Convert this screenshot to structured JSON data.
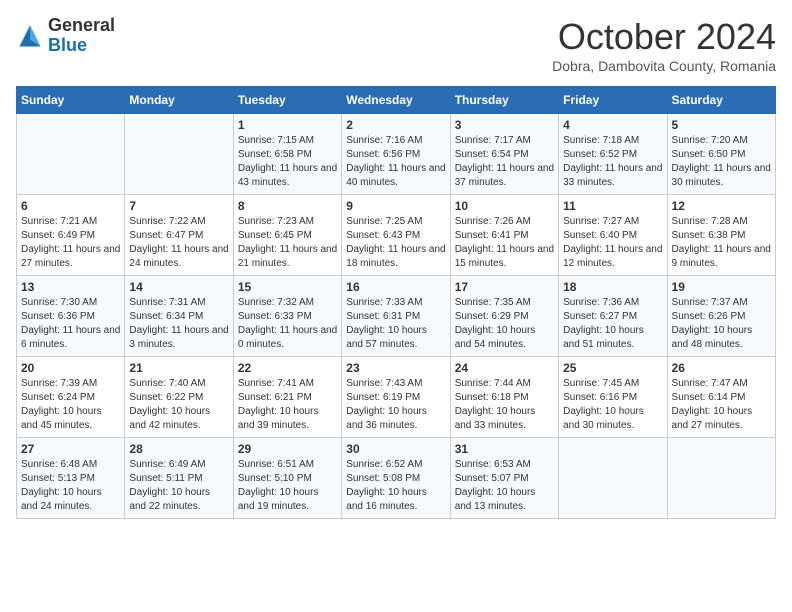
{
  "header": {
    "logo_general": "General",
    "logo_blue": "Blue",
    "month": "October 2024",
    "location": "Dobra, Dambovita County, Romania"
  },
  "days_of_week": [
    "Sunday",
    "Monday",
    "Tuesday",
    "Wednesday",
    "Thursday",
    "Friday",
    "Saturday"
  ],
  "weeks": [
    [
      {
        "day": "",
        "info": ""
      },
      {
        "day": "",
        "info": ""
      },
      {
        "day": "1",
        "info": "Sunrise: 7:15 AM\nSunset: 6:58 PM\nDaylight: 11 hours and 43 minutes."
      },
      {
        "day": "2",
        "info": "Sunrise: 7:16 AM\nSunset: 6:56 PM\nDaylight: 11 hours and 40 minutes."
      },
      {
        "day": "3",
        "info": "Sunrise: 7:17 AM\nSunset: 6:54 PM\nDaylight: 11 hours and 37 minutes."
      },
      {
        "day": "4",
        "info": "Sunrise: 7:18 AM\nSunset: 6:52 PM\nDaylight: 11 hours and 33 minutes."
      },
      {
        "day": "5",
        "info": "Sunrise: 7:20 AM\nSunset: 6:50 PM\nDaylight: 11 hours and 30 minutes."
      }
    ],
    [
      {
        "day": "6",
        "info": "Sunrise: 7:21 AM\nSunset: 6:49 PM\nDaylight: 11 hours and 27 minutes."
      },
      {
        "day": "7",
        "info": "Sunrise: 7:22 AM\nSunset: 6:47 PM\nDaylight: 11 hours and 24 minutes."
      },
      {
        "day": "8",
        "info": "Sunrise: 7:23 AM\nSunset: 6:45 PM\nDaylight: 11 hours and 21 minutes."
      },
      {
        "day": "9",
        "info": "Sunrise: 7:25 AM\nSunset: 6:43 PM\nDaylight: 11 hours and 18 minutes."
      },
      {
        "day": "10",
        "info": "Sunrise: 7:26 AM\nSunset: 6:41 PM\nDaylight: 11 hours and 15 minutes."
      },
      {
        "day": "11",
        "info": "Sunrise: 7:27 AM\nSunset: 6:40 PM\nDaylight: 11 hours and 12 minutes."
      },
      {
        "day": "12",
        "info": "Sunrise: 7:28 AM\nSunset: 6:38 PM\nDaylight: 11 hours and 9 minutes."
      }
    ],
    [
      {
        "day": "13",
        "info": "Sunrise: 7:30 AM\nSunset: 6:36 PM\nDaylight: 11 hours and 6 minutes."
      },
      {
        "day": "14",
        "info": "Sunrise: 7:31 AM\nSunset: 6:34 PM\nDaylight: 11 hours and 3 minutes."
      },
      {
        "day": "15",
        "info": "Sunrise: 7:32 AM\nSunset: 6:33 PM\nDaylight: 11 hours and 0 minutes."
      },
      {
        "day": "16",
        "info": "Sunrise: 7:33 AM\nSunset: 6:31 PM\nDaylight: 10 hours and 57 minutes."
      },
      {
        "day": "17",
        "info": "Sunrise: 7:35 AM\nSunset: 6:29 PM\nDaylight: 10 hours and 54 minutes."
      },
      {
        "day": "18",
        "info": "Sunrise: 7:36 AM\nSunset: 6:27 PM\nDaylight: 10 hours and 51 minutes."
      },
      {
        "day": "19",
        "info": "Sunrise: 7:37 AM\nSunset: 6:26 PM\nDaylight: 10 hours and 48 minutes."
      }
    ],
    [
      {
        "day": "20",
        "info": "Sunrise: 7:39 AM\nSunset: 6:24 PM\nDaylight: 10 hours and 45 minutes."
      },
      {
        "day": "21",
        "info": "Sunrise: 7:40 AM\nSunset: 6:22 PM\nDaylight: 10 hours and 42 minutes."
      },
      {
        "day": "22",
        "info": "Sunrise: 7:41 AM\nSunset: 6:21 PM\nDaylight: 10 hours and 39 minutes."
      },
      {
        "day": "23",
        "info": "Sunrise: 7:43 AM\nSunset: 6:19 PM\nDaylight: 10 hours and 36 minutes."
      },
      {
        "day": "24",
        "info": "Sunrise: 7:44 AM\nSunset: 6:18 PM\nDaylight: 10 hours and 33 minutes."
      },
      {
        "day": "25",
        "info": "Sunrise: 7:45 AM\nSunset: 6:16 PM\nDaylight: 10 hours and 30 minutes."
      },
      {
        "day": "26",
        "info": "Sunrise: 7:47 AM\nSunset: 6:14 PM\nDaylight: 10 hours and 27 minutes."
      }
    ],
    [
      {
        "day": "27",
        "info": "Sunrise: 6:48 AM\nSunset: 5:13 PM\nDaylight: 10 hours and 24 minutes."
      },
      {
        "day": "28",
        "info": "Sunrise: 6:49 AM\nSunset: 5:11 PM\nDaylight: 10 hours and 22 minutes."
      },
      {
        "day": "29",
        "info": "Sunrise: 6:51 AM\nSunset: 5:10 PM\nDaylight: 10 hours and 19 minutes."
      },
      {
        "day": "30",
        "info": "Sunrise: 6:52 AM\nSunset: 5:08 PM\nDaylight: 10 hours and 16 minutes."
      },
      {
        "day": "31",
        "info": "Sunrise: 6:53 AM\nSunset: 5:07 PM\nDaylight: 10 hours and 13 minutes."
      },
      {
        "day": "",
        "info": ""
      },
      {
        "day": "",
        "info": ""
      }
    ]
  ]
}
